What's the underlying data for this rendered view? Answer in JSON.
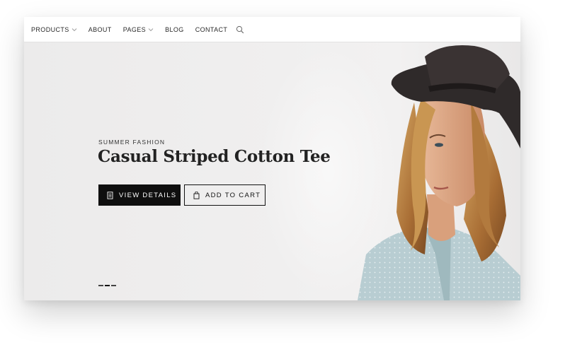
{
  "nav": {
    "items": [
      {
        "label": "PRODUCTS",
        "dropdown": true
      },
      {
        "label": "ABOUT",
        "dropdown": false
      },
      {
        "label": "PAGES",
        "dropdown": true
      },
      {
        "label": "BLOG",
        "dropdown": false
      },
      {
        "label": "CONTACT",
        "dropdown": false
      }
    ],
    "search_icon": "search-icon"
  },
  "hero": {
    "eyebrow": "SUMMER FASHION",
    "title": "Casual Striped Cotton Tee",
    "primary_button": {
      "label": "VIEW DETAILS",
      "icon": "document-icon"
    },
    "secondary_button": {
      "label": "ADD TO CART",
      "icon": "shopping-bag-icon"
    },
    "slides": {
      "count": 3,
      "active": 2
    }
  },
  "colors": {
    "primary": "#0f0f0f",
    "hero_bg": "#efeeee",
    "text": "#222222"
  }
}
